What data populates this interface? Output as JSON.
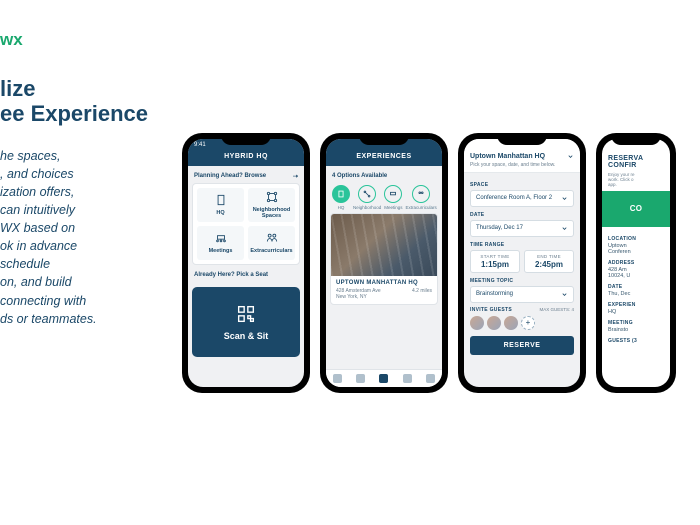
{
  "brand": "wx",
  "title_line1": "lize",
  "title_line2": "ee Experience",
  "description": "he spaces,\n, and choices\nization offers,\ncan intuitively\nWX based on\nok in advance\nschedule\non, and build\nconnecting with\nds or teammates.",
  "phone1": {
    "time": "9:41",
    "header": "HYBRID HQ",
    "planning_label": "Planning Ahead? Browse",
    "tiles": [
      "HQ",
      "Neighborhood Spaces",
      "Meetings",
      "Extracurriculars"
    ],
    "already_here": "Already Here? Pick a Seat",
    "scan_label": "Scan & Sit"
  },
  "phone2": {
    "header": "EXPERIENCES",
    "options": "4 Options Available",
    "categories": [
      "HQ",
      "Neighborhood",
      "Meetings",
      "Extracurriculars"
    ],
    "card": {
      "title": "UPTOWN MANHATTAN HQ",
      "address": "428 Amsterdam Ave",
      "city": "New York, NY",
      "distance": "4.2 miles"
    }
  },
  "phone3": {
    "location_title": "Uptown Manhattan HQ",
    "pick_label": "Pick your space, date, and time below.",
    "space_label": "SPACE",
    "space_value": "Conference Room A, Floor 2",
    "date_label": "DATE",
    "date_value": "Thursday, Dec 17",
    "time_label": "TIME RANGE",
    "start_label": "START TIME",
    "start_value": "1:15pm",
    "end_label": "END TIME",
    "end_value": "2:45pm",
    "topic_label": "MEETING TOPIC",
    "topic_value": "Brainstorming",
    "invite_label": "INVITE GUESTS",
    "max_label": "MAX GUESTS: 4",
    "reserve": "RESERVE"
  },
  "phone4": {
    "header1": "RESERVA",
    "header2": "CONFIR",
    "instruction": "Enjoy your re\nwork. Click o\napp.",
    "greenbar": "CO",
    "location_label": "LOCATION",
    "location_value": "Uptown\nConferen",
    "address_label": "ADDRESS",
    "address_value": "428 Am\n10024, U",
    "date_label": "DATE",
    "date_value": "Thu, Dec",
    "exp_label": "EXPERIEN",
    "exp_value": "HQ",
    "meeting_label": "MEETING",
    "meeting_value": "Brainsto",
    "guests_label": "GUESTS (3"
  }
}
